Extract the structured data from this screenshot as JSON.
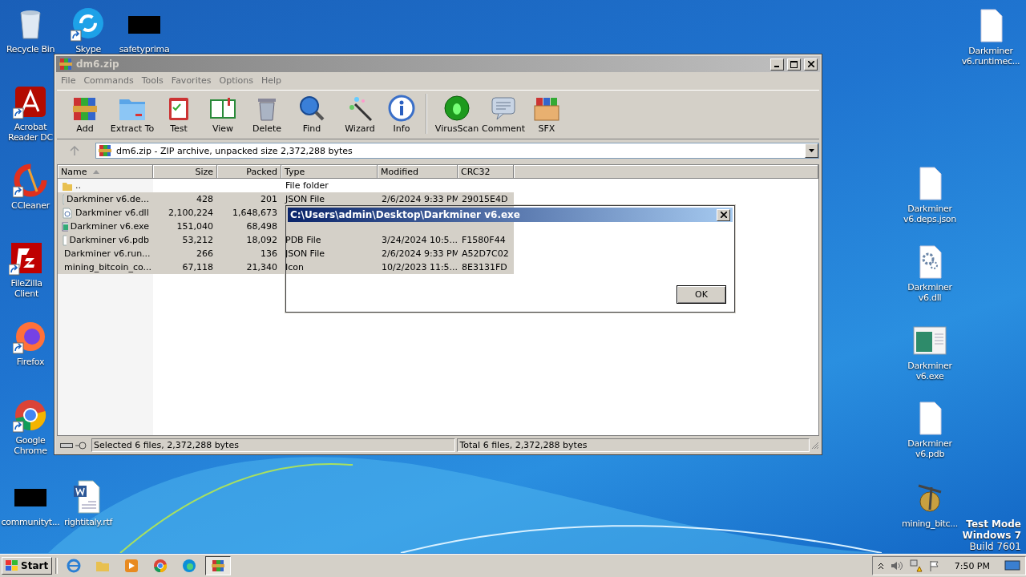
{
  "desktop": {
    "icons": [
      {
        "label": "Recycle Bin",
        "kind": "recycle",
        "shortcut": false
      },
      {
        "label": "Skype",
        "kind": "skype",
        "shortcut": true
      },
      {
        "label": "safetyprima",
        "kind": "thumbnail",
        "shortcut": false
      },
      {
        "label": "Acrobat Reader DC",
        "kind": "acrobat",
        "shortcut": true
      },
      {
        "label": "CCleaner",
        "kind": "ccleaner",
        "shortcut": true
      },
      {
        "label": "FileZilla Client",
        "kind": "filezilla",
        "shortcut": true
      },
      {
        "label": "Firefox",
        "kind": "firefox",
        "shortcut": true
      },
      {
        "label": "Google Chrome",
        "kind": "chrome",
        "shortcut": true
      },
      {
        "label": "communityt...",
        "kind": "thumbnail",
        "shortcut": false
      },
      {
        "label": "rightitaly.rtf",
        "kind": "word",
        "shortcut": false
      },
      {
        "label": "Darkminer v6.runtimec...",
        "kind": "blank",
        "shortcut": false
      },
      {
        "label": "Darkminer v6.deps.json",
        "kind": "blank",
        "shortcut": false
      },
      {
        "label": "Darkminer v6.dll",
        "kind": "settings",
        "shortcut": false
      },
      {
        "label": "Darkminer v6.exe",
        "kind": "app",
        "shortcut": false
      },
      {
        "label": "Darkminer v6.pdb",
        "kind": "blank",
        "shortcut": false
      },
      {
        "label": "mining_bitc...",
        "kind": "miner",
        "shortcut": false
      }
    ],
    "os_notice": [
      "Test Mode",
      "Windows 7",
      "Build 7601"
    ]
  },
  "window": {
    "title": "dm6.zip",
    "active": false,
    "menu": [
      "File",
      "Commands",
      "Tools",
      "Favorites",
      "Options",
      "Help"
    ],
    "toolbar": [
      {
        "label": "Add",
        "kind": "add"
      },
      {
        "label": "Extract To",
        "kind": "extract"
      },
      {
        "label": "Test",
        "kind": "test"
      },
      {
        "label": "View",
        "kind": "view"
      },
      {
        "label": "Delete",
        "kind": "delete"
      },
      {
        "label": "Find",
        "kind": "find"
      },
      {
        "label": "Wizard",
        "kind": "wizard"
      },
      {
        "label": "Info",
        "kind": "info"
      },
      {
        "label": "VirusScan",
        "kind": "virusscan"
      },
      {
        "label": "Comment",
        "kind": "comment"
      },
      {
        "label": "SFX",
        "kind": "sfx"
      }
    ],
    "address": "dm6.zip - ZIP archive, unpacked size 2,372,288 bytes",
    "columns": [
      {
        "label": "Name",
        "sorted": true
      },
      {
        "label": "Size",
        "sorted": false
      },
      {
        "label": "Packed",
        "sorted": false
      },
      {
        "label": "Type",
        "sorted": false
      },
      {
        "label": "Modified",
        "sorted": false
      },
      {
        "label": "CRC32",
        "sorted": false
      }
    ],
    "rows": [
      {
        "kind": "folder",
        "name": "..",
        "type": "File folder",
        "selected": false
      },
      {
        "kind": "file",
        "name": "Darkminer v6.de...",
        "size": "428",
        "packed": "201",
        "type": "JSON File",
        "modified": "2/6/2024 9:33 PM",
        "crc": "29015E4D",
        "selected": true
      },
      {
        "kind": "dll",
        "name": "Darkminer v6.dll",
        "size": "2,100,224",
        "packed": "1,648,673",
        "selected": true
      },
      {
        "kind": "exe",
        "name": "Darkminer v6.exe",
        "size": "151,040",
        "packed": "68,498",
        "selected": true
      },
      {
        "kind": "file",
        "name": "Darkminer v6.pdb",
        "size": "53,212",
        "packed": "18,092",
        "type": "PDB File",
        "modified": "3/24/2024 10:5...",
        "crc": "F1580F44",
        "selected": true
      },
      {
        "kind": "file",
        "name": "Darkminer v6.run...",
        "size": "266",
        "packed": "136",
        "type": "JSON File",
        "modified": "2/6/2024 9:33 PM",
        "crc": "A52D7C02",
        "selected": true
      },
      {
        "kind": "file",
        "name": "mining_bitcoin_co...",
        "size": "67,118",
        "packed": "21,340",
        "type": "Icon",
        "modified": "10/2/2023 11:5...",
        "crc": "8E3131FD",
        "selected": true
      }
    ],
    "status_left": "Selected 6 files, 2,372,288 bytes",
    "status_right": "Total 6 files, 2,372,288 bytes"
  },
  "dialog": {
    "title": "C:\\Users\\admin\\Desktop\\Darkminer v6.exe",
    "button": "OK"
  },
  "taskbar": {
    "start": "Start",
    "apps": [
      {
        "kind": "ie",
        "active": false
      },
      {
        "kind": "explorer",
        "active": false
      },
      {
        "kind": "media",
        "active": false
      },
      {
        "kind": "chrome",
        "active": false
      },
      {
        "kind": "edge",
        "active": false
      },
      {
        "kind": "winrar",
        "active": true
      }
    ],
    "clock": "7:50 PM"
  }
}
